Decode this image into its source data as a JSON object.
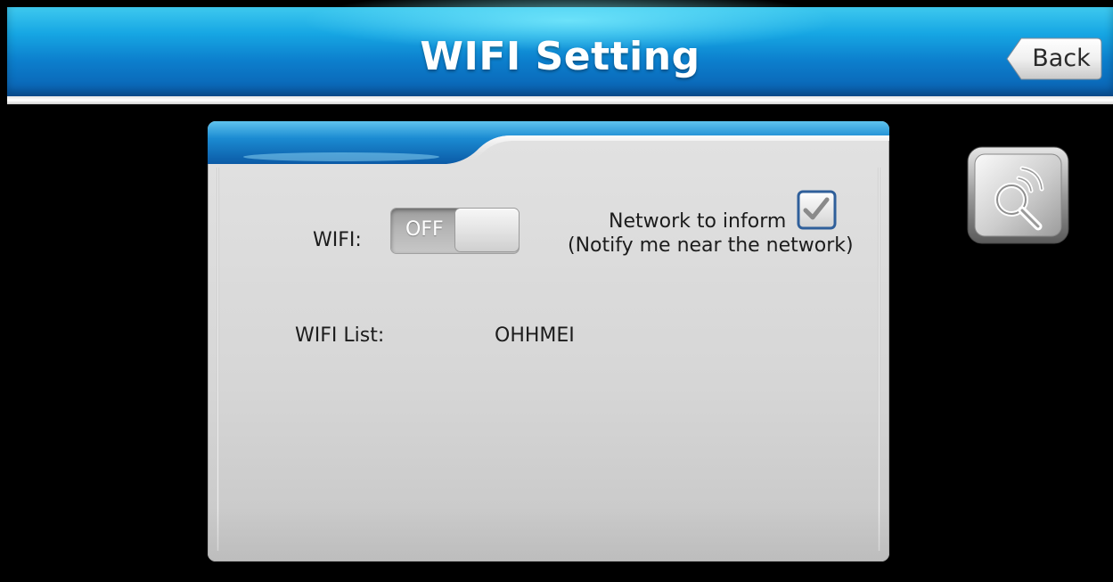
{
  "header": {
    "title": "WIFI Setting",
    "back_label": "Back"
  },
  "wifi": {
    "label": "WIFI:",
    "toggle_state_text": "OFF",
    "enabled": false
  },
  "notify": {
    "label": "Network to inform",
    "sublabel": "(Notify me near the network)",
    "checked": true
  },
  "wifi_list": {
    "label": "WIFI List:",
    "networks": [
      "OHHMEI"
    ]
  },
  "icons": {
    "scan": "wifi-search-icon",
    "check": "checkmark-icon"
  },
  "colors": {
    "header_blue": "#0c7fcd",
    "header_glow": "#3ec9ef",
    "panel_gray": "#d6d6d6",
    "check_blue": "#2f5f9a"
  }
}
